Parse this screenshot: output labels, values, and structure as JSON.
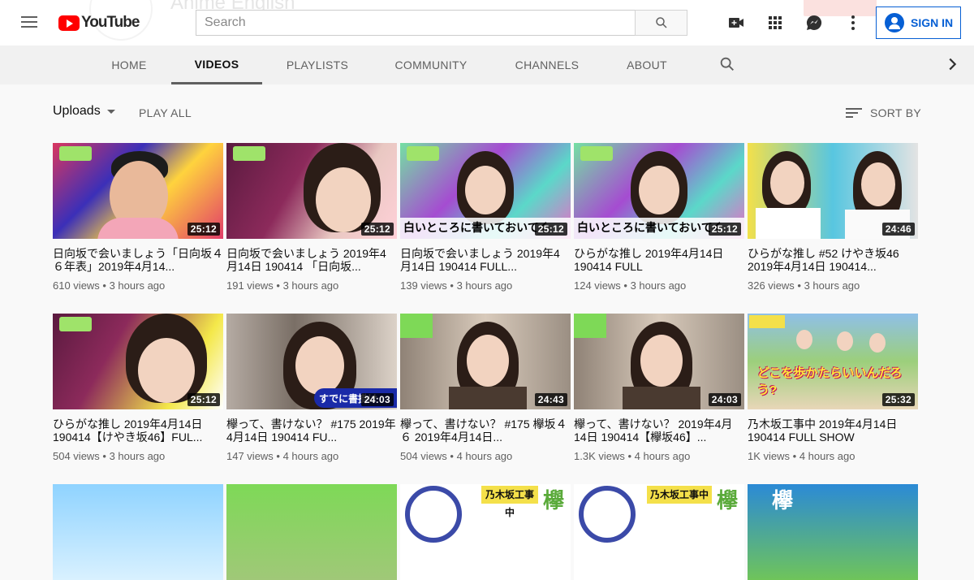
{
  "header": {
    "logo_text": "YouTube",
    "search_placeholder": "Search",
    "signin_label": "SIGN IN",
    "ghost_channel": "Anime English"
  },
  "tabs": [
    {
      "label": "HOME"
    },
    {
      "label": "VIDEOS"
    },
    {
      "label": "PLAYLISTS"
    },
    {
      "label": "COMMUNITY"
    },
    {
      "label": "CHANNELS"
    },
    {
      "label": "ABOUT"
    }
  ],
  "filter": {
    "uploads_label": "Uploads",
    "play_all_label": "PLAY ALL",
    "sort_label": "SORT BY"
  },
  "videos": [
    {
      "title": "日向坂で会いましょう「日向坂４６年表」2019年4月14...",
      "views": "610 views",
      "age": "3 hours ago",
      "duration": "25:12"
    },
    {
      "title": "日向坂で会いましょう 2019年4月14日 190414 「日向坂...",
      "views": "191 views",
      "age": "3 hours ago",
      "duration": "25:12"
    },
    {
      "title": "日向坂で会いましょう 2019年4月14日 190414 FULL...",
      "views": "139 views",
      "age": "3 hours ago",
      "duration": "25:12"
    },
    {
      "title": "ひらがな推し 2019年4月14日 190414 FULL",
      "views": "124 views",
      "age": "3 hours ago",
      "duration": "25:12"
    },
    {
      "title": "ひらがな推し #52 けやき坂46 2019年4月14日 190414...",
      "views": "326 views",
      "age": "3 hours ago",
      "duration": "24:46"
    },
    {
      "title": "ひらがな推し 2019年4月14日 190414【けやき坂46】FUL...",
      "views": "504 views",
      "age": "3 hours ago",
      "duration": "25:12"
    },
    {
      "title": "欅って、書けない？ #175 2019年4月14日 190414 FU...",
      "views": "147 views",
      "age": "4 hours ago",
      "duration": "24:03"
    },
    {
      "title": "欅って、書けない？ #175 欅坂４６ 2019年4月14日...",
      "views": "504 views",
      "age": "4 hours ago",
      "duration": "24:43"
    },
    {
      "title": "欅って、書けない？ 2019年4月14日 190414【欅坂46】...",
      "views": "1.3K views",
      "age": "4 hours ago",
      "duration": "24:03"
    },
    {
      "title": "乃木坂工事中 2019年4月14日 190414 FULL SHOW",
      "views": "1K views",
      "age": "4 hours ago",
      "duration": "25:32"
    }
  ],
  "thumb_captions": {
    "v3": "白いところに書いておいてく",
    "v4": "白いところに書いておいてく",
    "v7": "すでに書掛け",
    "v10": "どこを歩かたらいいんだろう?",
    "r3a": "乃木坂工事中",
    "r3b": "欅",
    "r3c": "乃木坂工事中",
    "r3d": "欅",
    "r3e": "欅"
  },
  "colors": {
    "brand_red": "#ff0000",
    "link_blue": "#065fd4",
    "text_secondary": "#606060"
  }
}
